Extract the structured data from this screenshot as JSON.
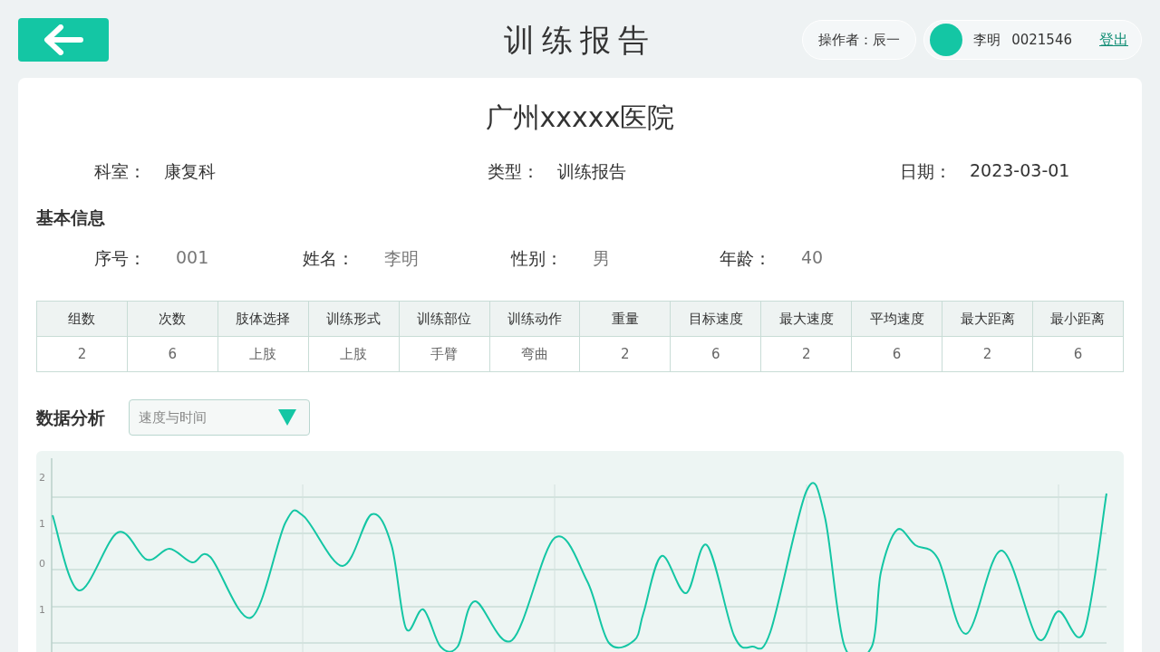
{
  "header": {
    "title": "训练报告",
    "operator": "操作者：辰一",
    "user": {
      "name": "李明",
      "id": "0021546"
    },
    "logout": "登出"
  },
  "report": {
    "hospital": "广州xxxxx医院",
    "meta": [
      {
        "label": "科室：",
        "value": "康复科"
      },
      {
        "label": "类型：",
        "value": "训练报告"
      },
      {
        "label": "日期：",
        "value": "2023-03-01"
      }
    ],
    "basic_info": {
      "title": "基本信息",
      "fields": [
        {
          "label": "序号：",
          "value": "001"
        },
        {
          "label": "姓名：",
          "value": "李明"
        },
        {
          "label": "性别：",
          "value": "男"
        },
        {
          "label": "年龄：",
          "value": "40"
        }
      ]
    },
    "table": {
      "columns": [
        "组数",
        "次数",
        "肢体选择",
        "训练形式",
        "训练部位",
        "训练动作",
        "重量",
        "目标速度",
        "最大速度",
        "平均速度",
        "最大距离",
        "最小距离"
      ],
      "rows": [
        [
          "2",
          "6",
          "上肢",
          "上肢",
          "手臂",
          "弯曲",
          "2",
          "6",
          "2",
          "6",
          "2",
          "6"
        ]
      ]
    },
    "analysis": {
      "title": "数据分析",
      "dropdown": {
        "value": "速度与时间"
      },
      "chart": {
        "y_axis_labels": [
          "2",
          "1",
          "0",
          "1"
        ]
      }
    }
  }
}
